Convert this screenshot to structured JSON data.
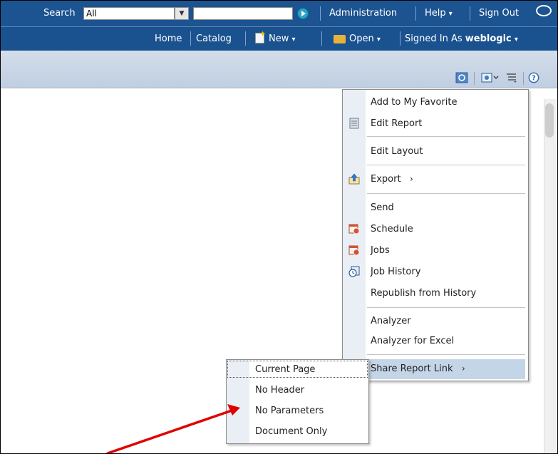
{
  "topbar": {
    "search_label": "Search",
    "search_scope": "All",
    "search_value": "",
    "links": [
      "Administration",
      "Help",
      "Sign Out"
    ],
    "help_chevron": "⌄"
  },
  "navbar": {
    "home": "Home",
    "catalog": "Catalog",
    "new": "New",
    "open": "Open",
    "signed_in_as": "Signed In As",
    "user": "weblogic"
  },
  "menu": {
    "items": [
      {
        "label": "Add to My Favorite",
        "icon": "none"
      },
      {
        "label": "Edit Report",
        "icon": "report-icon"
      },
      {
        "label": "Edit Layout",
        "icon": "none"
      },
      {
        "label": "Export",
        "icon": "export-icon",
        "submenu": true
      },
      {
        "label": "Send",
        "icon": "none"
      },
      {
        "label": "Schedule",
        "icon": "schedule-icon"
      },
      {
        "label": "Jobs",
        "icon": "jobs-icon"
      },
      {
        "label": "Job History",
        "icon": "job-history-icon"
      },
      {
        "label": "Republish from History",
        "icon": "none"
      },
      {
        "label": "Analyzer",
        "icon": "none"
      },
      {
        "label": "Analyzer for Excel",
        "icon": "none"
      },
      {
        "label": "Share Report Link",
        "icon": "none",
        "submenu": true,
        "highlighted": true
      }
    ],
    "submenu_arrow": "›"
  },
  "submenu": {
    "items": [
      "Current Page",
      "No Header",
      "No Parameters",
      "Document Only"
    ]
  },
  "colors": {
    "header_blue": "#1c5391",
    "toolbar": "#c9d6e6",
    "menu_highlight": "#c5d5e8",
    "annotation_red": "#e00000"
  }
}
